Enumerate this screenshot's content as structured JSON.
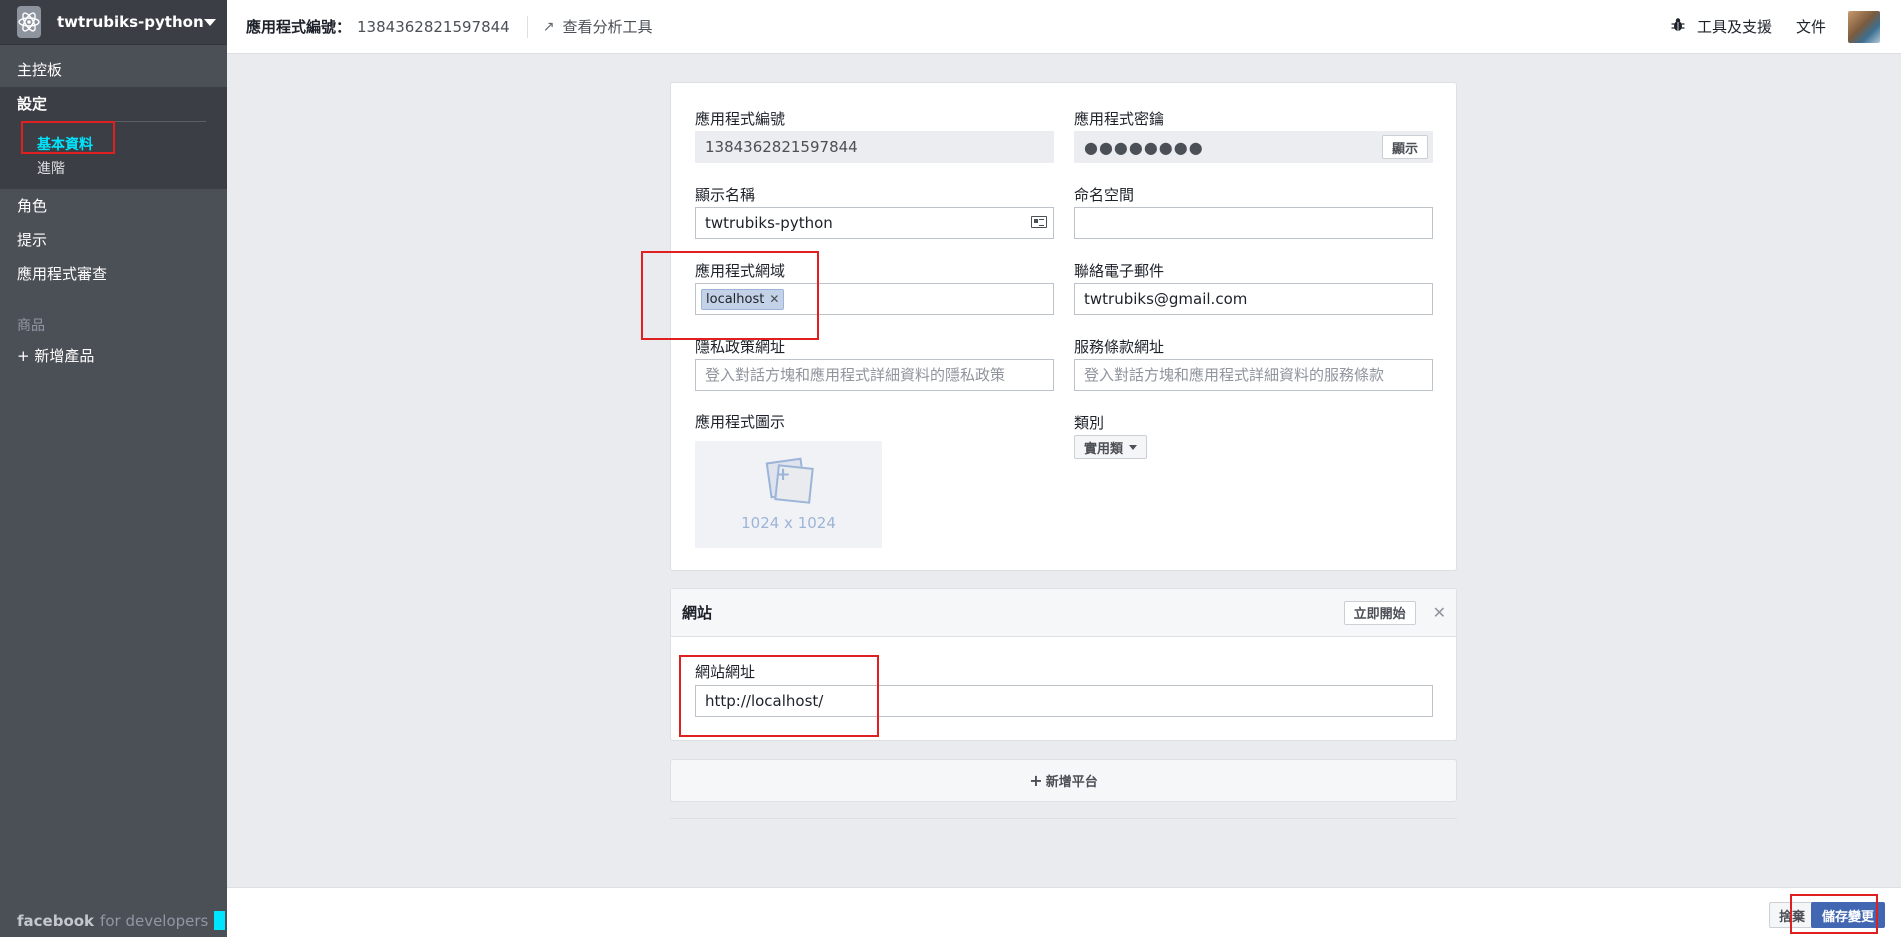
{
  "sidebar": {
    "app_name": "twtrubiks-python",
    "items": {
      "dashboard": "主控板",
      "settings": "設定",
      "basic": "基本資料",
      "advanced": "進階",
      "roles": "角色",
      "alerts": "提示",
      "app_review": "應用程式審查",
      "products_heading": "商品",
      "add_product": "+ 新增產品"
    },
    "footer": {
      "brand": "facebook",
      "suffix": "for developers"
    }
  },
  "topbar": {
    "app_id_label": "應用程式編號：",
    "app_id_value": "1384362821597844",
    "analytics": "查看分析工具",
    "tools": "工具及支援",
    "docs": "文件"
  },
  "basic": {
    "app_id_label": "應用程式編號",
    "app_id_value": "1384362821597844",
    "secret_label": "應用程式密鑰",
    "secret_value": "●●●●●●●●",
    "show_button": "顯示",
    "display_name_label": "顯示名稱",
    "display_name_value": "twtrubiks-python",
    "namespace_label": "命名空間",
    "namespace_value": "",
    "domains_label": "應用程式網域",
    "domain_token": "localhost",
    "email_label": "聯絡電子郵件",
    "email_value": "twtrubiks@gmail.com",
    "privacy_label": "隱私政策網址",
    "privacy_placeholder": "登入對話方塊和應用程式詳細資料的隱私政策",
    "tos_label": "服務條款網址",
    "tos_placeholder": "登入對話方塊和應用程式詳細資料的服務條款",
    "icon_label": "應用程式圖示",
    "icon_size": "1024 x 1024",
    "category_label": "類別",
    "category_value": "實用類"
  },
  "website": {
    "title": "網站",
    "quickstart": "立即開始",
    "url_label": "網站網址",
    "url_value": "http://localhost/"
  },
  "add_platform": "新增平台",
  "actions": {
    "discard": "捨棄",
    "save": "儲存變更"
  },
  "colors": {
    "sidebar_bg": "#4b4f56",
    "accent": "#4267b2",
    "active_link": "#00e5ff",
    "highlight": "#e02020"
  }
}
